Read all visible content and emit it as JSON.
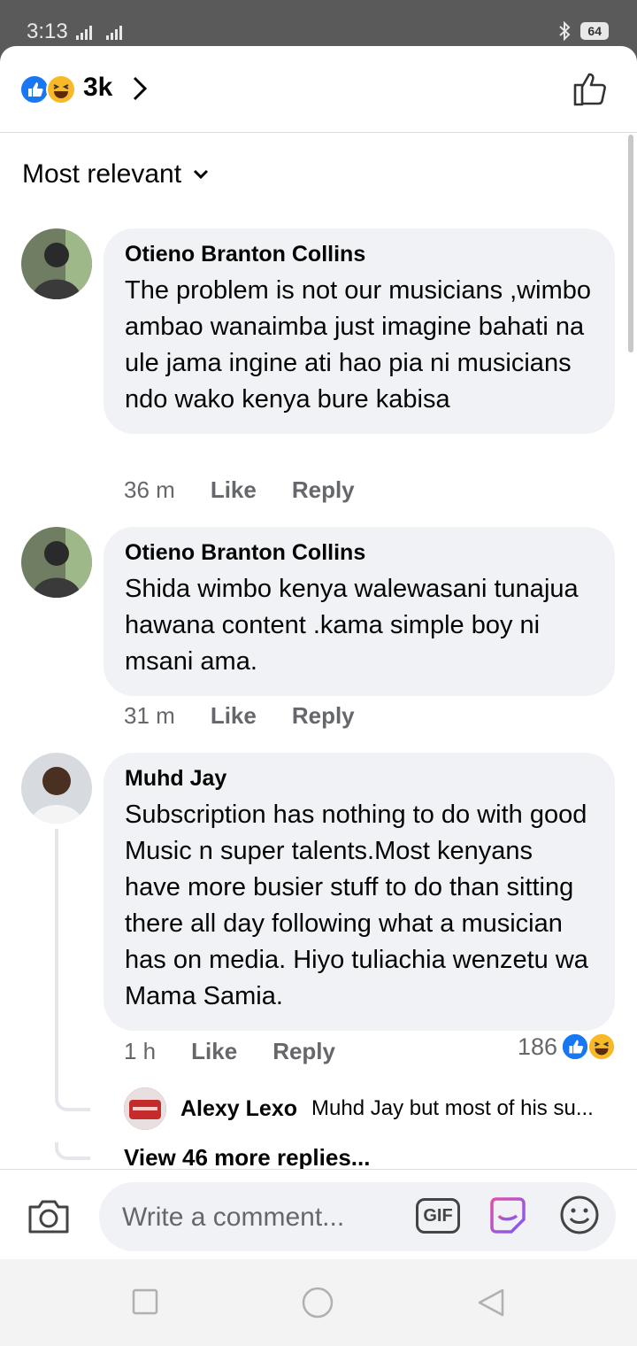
{
  "status": {
    "time": "3:13",
    "battery": "64"
  },
  "header": {
    "reaction_count": "3k"
  },
  "sort": {
    "label": "Most relevant"
  },
  "comments": [
    {
      "author": "Otieno Branton Collins",
      "text": "The problem is not our musicians ,wimbo ambao wanaimba just imagine bahati na ule jama ingine ati hao pia ni musicians ndo wako kenya bure kabisa",
      "time": "36 m",
      "like": "Like",
      "reply": "Reply"
    },
    {
      "author": "Otieno Branton Collins",
      "text": "Shida wimbo kenya walewasani tunajua hawana content .kama simple boy ni msani ama.",
      "time": "31 m",
      "like": "Like",
      "reply": "Reply"
    },
    {
      "author": "Muhd Jay",
      "text": "Subscription has nothing to do with good Music n super talents.Most kenyans have more busier stuff to do than sitting there all day following what a musician has on media. Hiyo tuliachia wenzetu wa Mama Samia.",
      "time": "1 h",
      "like": "Like",
      "reply": "Reply",
      "reactions": "186"
    }
  ],
  "reply_preview": {
    "author": "Alexy Lexo",
    "text": "Muhd Jay but most of his su..."
  },
  "view_more": "View 46 more replies...",
  "composer": {
    "placeholder": "Write a comment...",
    "gif_label": "GIF"
  },
  "colors": {
    "like_blue": "#1877f2",
    "haha_yellow": "#f7b928",
    "bubble_bg": "#f0f2f5",
    "meta_gray": "#65676b"
  }
}
